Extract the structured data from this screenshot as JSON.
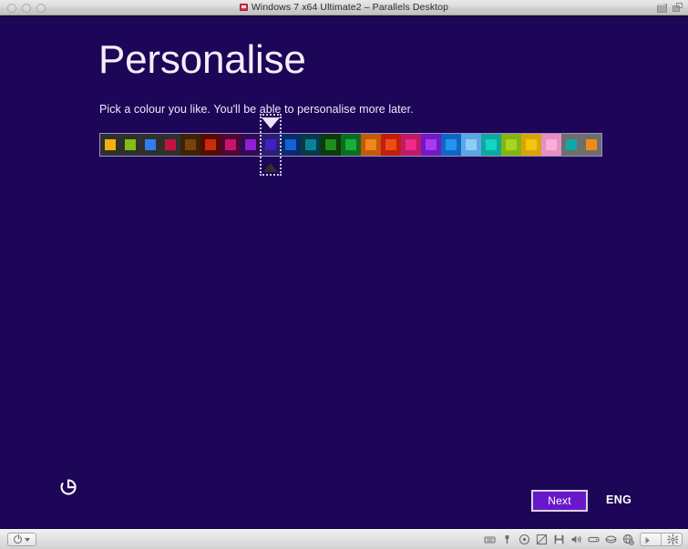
{
  "window": {
    "title": "Windows 7 x64 Ultimate2 – Parallels Desktop",
    "app_icon": "parallels-window-icon",
    "traffic_lights": [
      "close-button",
      "minimize-button",
      "zoom-button"
    ],
    "right_icons": [
      "window-restore-icon",
      "fullscreen-icon"
    ]
  },
  "guest": {
    "background_color": "#1d0557",
    "heading": "Personalise",
    "subtitle": "Pick a colour you like. You'll be able to personalise more later.",
    "ease_of_access_label": "ease-of-access",
    "next_label": "Next",
    "ime_label": "ENG",
    "selected_index": 8,
    "accent_color": "#6818c9",
    "swatches": [
      {
        "name": "amber",
        "bg": "#2f2f2f",
        "chip": "#f3b10a"
      },
      {
        "name": "lime",
        "bg": "#2f2f2f",
        "chip": "#7fc011"
      },
      {
        "name": "azure",
        "bg": "#2f2f2f",
        "chip": "#2f7ef0"
      },
      {
        "name": "crimson",
        "bg": "#2f2f2f",
        "chip": "#c2143f"
      },
      {
        "name": "dark-brown",
        "bg": "#3d2206",
        "chip": "#7a4408"
      },
      {
        "name": "dark-red",
        "bg": "#550b04",
        "chip": "#c92c0a"
      },
      {
        "name": "magenta",
        "bg": "#4d0733",
        "chip": "#c61570"
      },
      {
        "name": "violet",
        "bg": "#2f0b4f",
        "chip": "#8f1fd6"
      },
      {
        "name": "indigo",
        "bg": "#2a1f6e",
        "chip": "#4020c4"
      },
      {
        "name": "ocean-blue",
        "bg": "#0b2a6b",
        "chip": "#0f63d4"
      },
      {
        "name": "teal-dark",
        "bg": "#063a47",
        "chip": "#0a8296"
      },
      {
        "name": "forest-green",
        "bg": "#0a3b0a",
        "chip": "#1f8c1f"
      },
      {
        "name": "green",
        "bg": "#0f6b22",
        "chip": "#14b03a"
      },
      {
        "name": "orange-burnt",
        "bg": "#c25a0c",
        "chip": "#f0871a"
      },
      {
        "name": "red",
        "bg": "#c01f0b",
        "chip": "#f04a18"
      },
      {
        "name": "pink-deep",
        "bg": "#bd1a6a",
        "chip": "#f02a86"
      },
      {
        "name": "purple",
        "bg": "#7218c4",
        "chip": "#a839f0"
      },
      {
        "name": "blue",
        "bg": "#1166c4",
        "chip": "#1f95f0"
      },
      {
        "name": "light-blue",
        "bg": "#5aa6e8",
        "chip": "#8fccf5"
      },
      {
        "name": "turquoise",
        "bg": "#0fa8a0",
        "chip": "#14d4c4"
      },
      {
        "name": "yellow-green",
        "bg": "#84b512",
        "chip": "#a8d422"
      },
      {
        "name": "gold",
        "bg": "#dba30a",
        "chip": "#f0c70f"
      },
      {
        "name": "pink-light",
        "bg": "#e88ec4",
        "chip": "#f5b0d8"
      },
      {
        "name": "grey-teal",
        "bg": "#6e6e6e",
        "chip": "#0fa8a8"
      },
      {
        "name": "grey-orange",
        "bg": "#6e6e6e",
        "chip": "#f08b1a"
      }
    ]
  },
  "statusbar": {
    "power_label": "power-menu",
    "icons": [
      "keyboard-icon",
      "usb-icon",
      "cd-dvd-icon",
      "network-icon",
      "floppy-icon",
      "sound-icon",
      "hard-disk-icon",
      "shared-folder-icon",
      "globe-icon"
    ],
    "group_icons": [
      "play-icon",
      "gear-icon"
    ]
  }
}
